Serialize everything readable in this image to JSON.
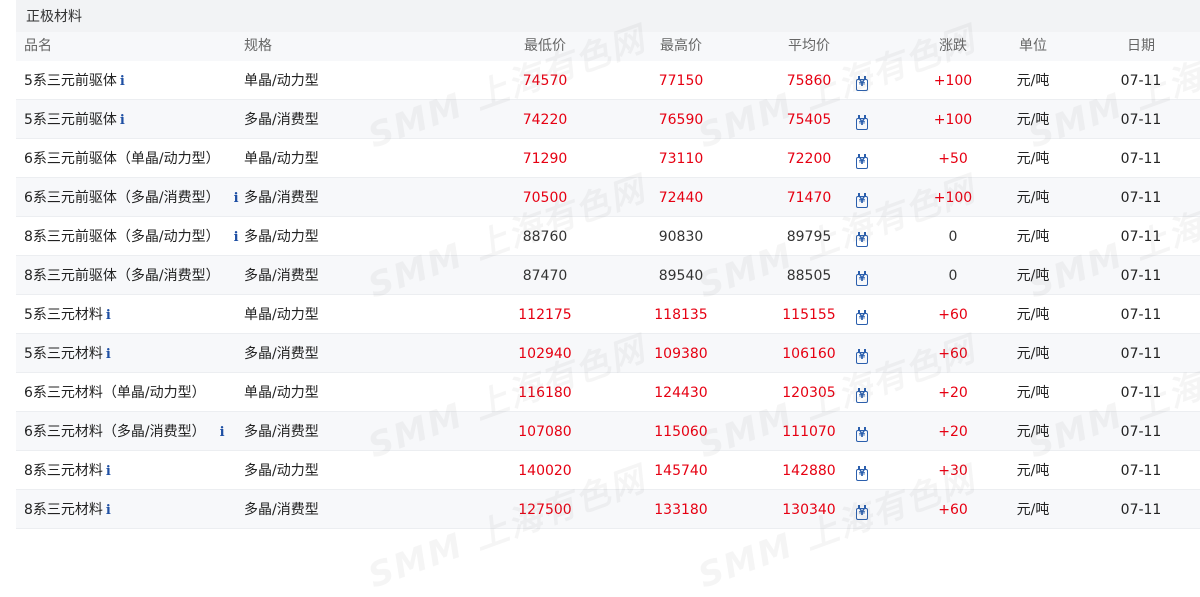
{
  "section": {
    "title": "正极材料"
  },
  "columns": {
    "name": "品名",
    "spec": "规格",
    "low": "最低价",
    "high": "最高价",
    "avg": "平均价",
    "change": "涨跌",
    "unit": "单位",
    "date": "日期"
  },
  "watermark": "SMM 上海有色网",
  "icons": {
    "info": "info-icon",
    "calendar": "calendar-price-icon"
  },
  "colors": {
    "up": "#e60012",
    "flat": "#333333",
    "info": "#1e4fa3",
    "header_bg": "#f2f3f5"
  },
  "rows": [
    {
      "name": "5系三元前驱体",
      "info": "i",
      "spec": "单晶/动力型",
      "low": "74570",
      "high": "77150",
      "avg": "75860",
      "change": "+100",
      "unit": "元/吨",
      "date": "07-11"
    },
    {
      "name": "5系三元前驱体",
      "info": "i",
      "spec": "多晶/消费型",
      "low": "74220",
      "high": "76590",
      "avg": "75405",
      "change": "+100",
      "unit": "元/吨",
      "date": "07-11"
    },
    {
      "name": "6系三元前驱体（单晶/动力型）",
      "info": "",
      "spec": "单晶/动力型",
      "low": "71290",
      "high": "73110",
      "avg": "72200",
      "change": "+50",
      "unit": "元/吨",
      "date": "07-11"
    },
    {
      "name": "6系三元前驱体（多晶/消费型）",
      "info": "i",
      "spec": "多晶/消费型",
      "low": "70500",
      "high": "72440",
      "avg": "71470",
      "change": "+100",
      "unit": "元/吨",
      "date": "07-11"
    },
    {
      "name": "8系三元前驱体（多晶/动力型）",
      "info": "i",
      "spec": "多晶/动力型",
      "low": "88760",
      "high": "90830",
      "avg": "89795",
      "change": "0",
      "unit": "元/吨",
      "date": "07-11"
    },
    {
      "name": "8系三元前驱体（多晶/消费型）",
      "info": "",
      "spec": "多晶/消费型",
      "low": "87470",
      "high": "89540",
      "avg": "88505",
      "change": "0",
      "unit": "元/吨",
      "date": "07-11"
    },
    {
      "name": "5系三元材料",
      "info": "i",
      "spec": "单晶/动力型",
      "low": "112175",
      "high": "118135",
      "avg": "115155",
      "change": "+60",
      "unit": "元/吨",
      "date": "07-11"
    },
    {
      "name": "5系三元材料",
      "info": "i",
      "spec": "多晶/消费型",
      "low": "102940",
      "high": "109380",
      "avg": "106160",
      "change": "+60",
      "unit": "元/吨",
      "date": "07-11"
    },
    {
      "name": "6系三元材料（单晶/动力型）",
      "info": "",
      "spec": "单晶/动力型",
      "low": "116180",
      "high": "124430",
      "avg": "120305",
      "change": "+20",
      "unit": "元/吨",
      "date": "07-11"
    },
    {
      "name": "6系三元材料（多晶/消费型）",
      "info": "i",
      "spec": "多晶/消费型",
      "low": "107080",
      "high": "115060",
      "avg": "111070",
      "change": "+20",
      "unit": "元/吨",
      "date": "07-11"
    },
    {
      "name": "8系三元材料",
      "info": "i",
      "spec": "多晶/动力型",
      "low": "140020",
      "high": "145740",
      "avg": "142880",
      "change": "+30",
      "unit": "元/吨",
      "date": "07-11"
    },
    {
      "name": "8系三元材料",
      "info": "i",
      "spec": "多晶/消费型",
      "low": "127500",
      "high": "133180",
      "avg": "130340",
      "change": "+60",
      "unit": "元/吨",
      "date": "07-11"
    }
  ]
}
